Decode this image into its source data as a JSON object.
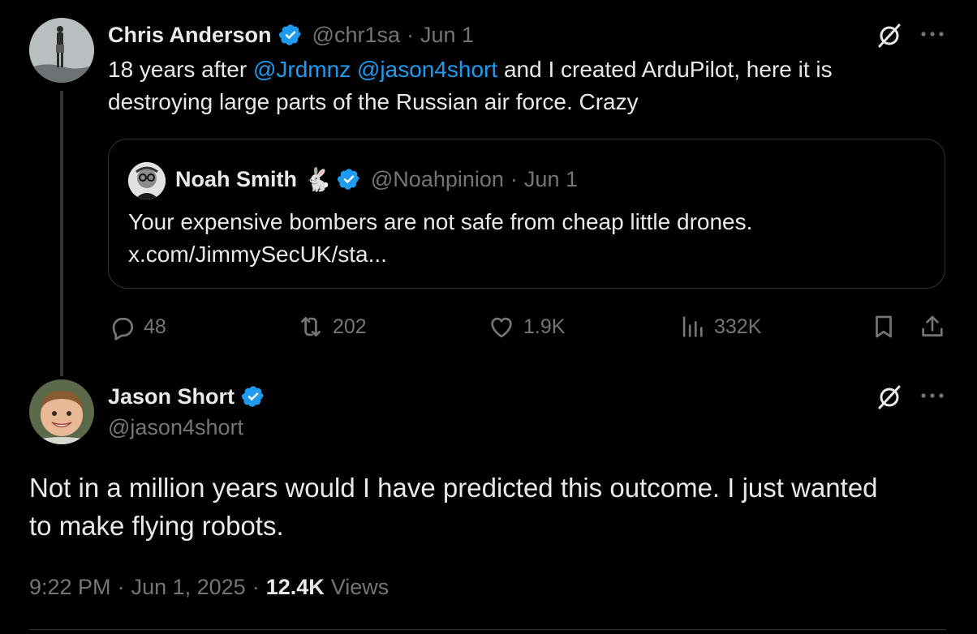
{
  "colors": {
    "background": "#000000",
    "text": "#e7e9ea",
    "muted": "#71767b",
    "link": "#1d9bf0",
    "verified": "#1d9bf0",
    "border": "#2f3336"
  },
  "first_tweet": {
    "author_name": "Chris Anderson",
    "handle": "@chr1sa",
    "separator": "·",
    "date": "Jun 1",
    "text_before": "18 years after ",
    "mention_1": "@Jrdmnz",
    "mention_2": "@jason4short",
    "text_after_1": " and I created ArduPilot, here it is",
    "text_line_2": "destroying large parts of the Russian air force. Crazy",
    "quoted": {
      "author_name": "Noah Smith",
      "emoji": "🐇",
      "handle": "@Noahpinion",
      "separator": "·",
      "date": "Jun 1",
      "text": "Your expensive bombers are not safe from cheap little drones.",
      "link": "x.com/JimmySecUK/sta..."
    },
    "actions": {
      "replies": "48",
      "reposts": "202",
      "likes": "1.9K",
      "views": "332K"
    }
  },
  "reply": {
    "author_name": "Jason Short",
    "handle": "@jason4short",
    "text_line_1": "Not in a million years would I have predicted this outcome. I just wanted",
    "text_line_2": "to make flying robots.",
    "time": "9:22 PM",
    "separator": "·",
    "date": "Jun 1, 2025",
    "separator_2": "·",
    "view_count": "12.4K",
    "views_label": "Views"
  },
  "icons": [
    "verified-badge-icon",
    "grok-icon",
    "more-icon",
    "reply-icon",
    "repost-icon",
    "like-icon",
    "views-icon",
    "bookmark-icon",
    "share-icon"
  ]
}
